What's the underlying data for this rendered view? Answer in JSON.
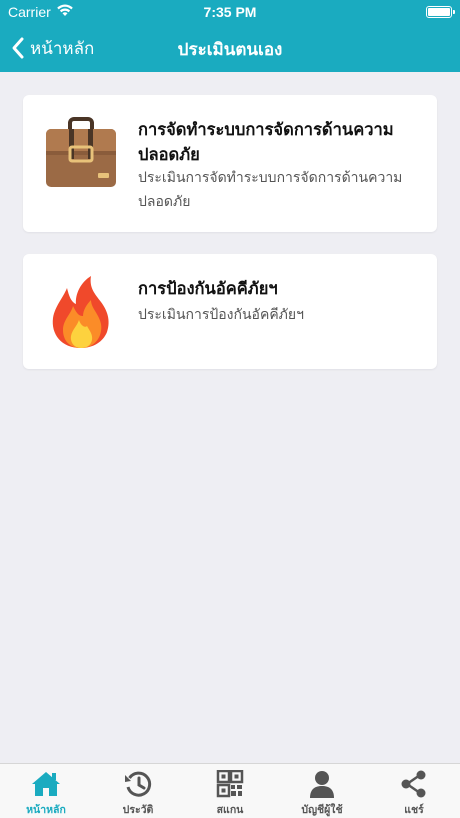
{
  "status_bar": {
    "carrier": "Carrier",
    "time": "7:35 PM"
  },
  "nav": {
    "back_label": "หน้าหลัก",
    "title": "ประเมินตนเอง"
  },
  "cards": [
    {
      "icon": "briefcase-icon",
      "title": "การจัดทำระบบการจัดการด้านความปลอดภัย",
      "description": "ประเมินการจัดทำระบบการจัดการด้านความปลอดภัย"
    },
    {
      "icon": "fire-icon",
      "title": "การป้องกันอัคคีภัยฯ",
      "description": "ประเมินการป้องกันอัคคีภัยฯ"
    }
  ],
  "tabs": [
    {
      "label": "หน้าหลัก",
      "icon": "home-icon",
      "active": true
    },
    {
      "label": "ประวัติ",
      "icon": "history-icon",
      "active": false
    },
    {
      "label": "สแกน",
      "icon": "qr-code-icon",
      "active": false
    },
    {
      "label": "บัญชีผู้ใช้",
      "icon": "user-icon",
      "active": false
    },
    {
      "label": "แชร์",
      "icon": "share-icon",
      "active": false
    }
  ],
  "colors": {
    "accent": "#1aabc0",
    "background": "#eeeef3",
    "tab_inactive": "#555555"
  }
}
